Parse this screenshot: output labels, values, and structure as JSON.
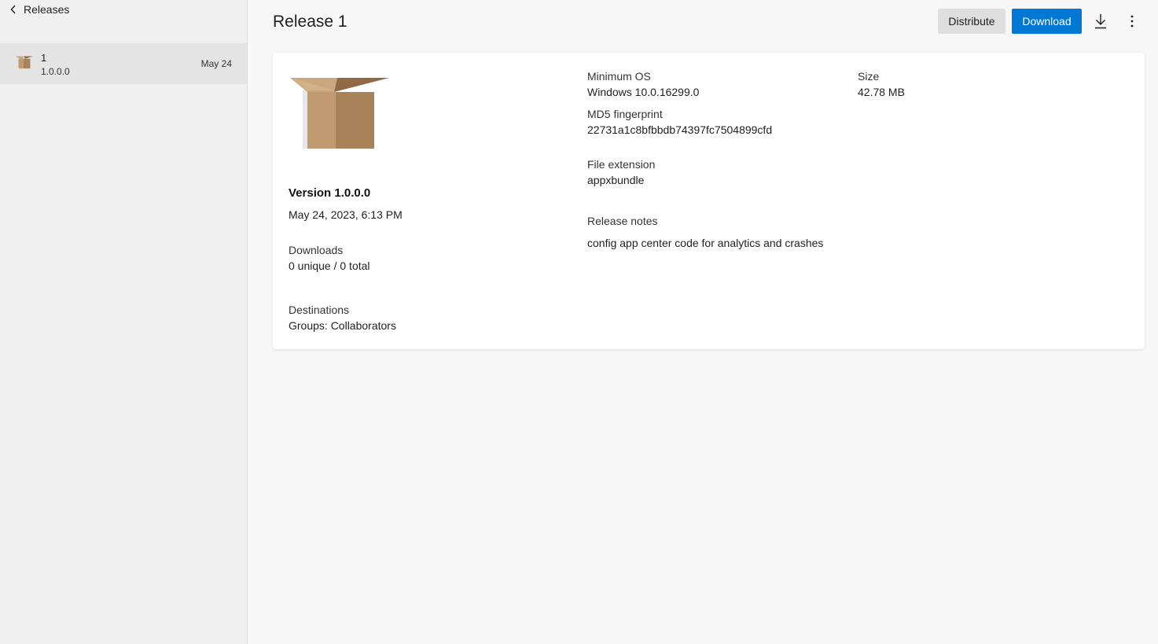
{
  "sidebar": {
    "back_label": "Releases",
    "items": [
      {
        "name": "1",
        "version": "1.0.0.0",
        "date": "May 24"
      }
    ]
  },
  "header": {
    "title": "Release 1",
    "distribute_label": "Distribute",
    "download_label": "Download",
    "icons": [
      "download-icon",
      "more-options-icon"
    ]
  },
  "details": {
    "version": "Version 1.0.0.0",
    "date": "May 24, 2023, 6:13 PM",
    "downloads_label": "Downloads",
    "downloads_value": "0 unique / 0 total",
    "destinations_label": "Destinations",
    "destinations_value": "Groups: Collaborators",
    "min_os_label": "Minimum OS",
    "min_os_value": "Windows 10.0.16299.0",
    "md5_label": "MD5 fingerprint",
    "md5_value": "22731a1c8bfbbdb74397fc7504899cfd",
    "file_ext_label": "File extension",
    "file_ext_value": "appxbundle",
    "release_notes_label": "Release notes",
    "release_notes_value": "config app center code for analytics and crashes",
    "size_label": "Size",
    "size_value": "42.78 MB"
  },
  "colors": {
    "accent": "#0078d4",
    "box_light": "#c09a70",
    "box_dark": "#a88359"
  }
}
